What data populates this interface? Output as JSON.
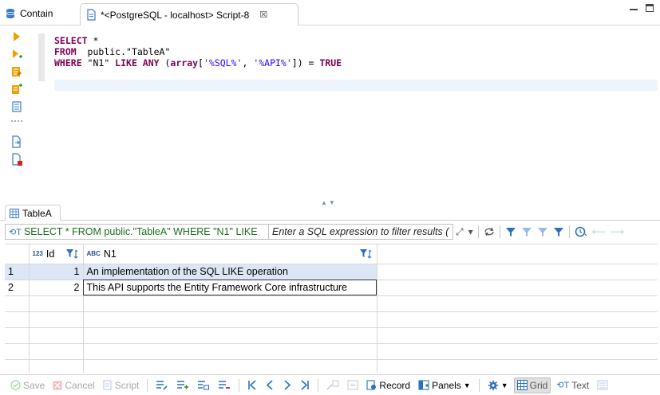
{
  "tabs": {
    "contain": "Contain",
    "script": "*<PostgreSQL - localhost> Script-8",
    "close_glyph": "☒"
  },
  "editor": {
    "line1": {
      "kw": "SELECT",
      "rest": " *"
    },
    "line2": {
      "kw": "FROM",
      "rest": "  public.\"TableA\""
    },
    "line3": {
      "kw1": "WHERE",
      "t1": " \"N1\" ",
      "kw2": "LIKE ANY",
      "t2": " (",
      "kw3": "array",
      "t3": "[",
      "s1": "'%SQL%'",
      "t4": ", ",
      "s2": "'%API%'",
      "t5": "]) = ",
      "kw4": "TRUE"
    }
  },
  "results": {
    "tab_label": "TableA",
    "filter_query": "SELECT * FROM public.\"TableA\" WHERE \"N1\" LIKE",
    "filter_placeholder": "Enter a SQL expression to filter results (use Ctrl+Space)",
    "columns": [
      {
        "type": "123",
        "name": "Id"
      },
      {
        "type": "ABC",
        "name": "N1"
      }
    ],
    "rows": [
      {
        "num": "1",
        "id": "1",
        "n1": "An implementation of the SQL LIKE operation"
      },
      {
        "num": "2",
        "id": "2",
        "n1": "This API supports the Entity Framework Core infrastructure"
      }
    ]
  },
  "toolbar": {
    "save": "Save",
    "cancel": "Cancel",
    "script": "Script",
    "record": "Record",
    "panels": "Panels",
    "grid": "Grid",
    "text": "Text"
  },
  "colors": {
    "keyword": "#7f0055",
    "string": "#2a00ff",
    "selection": "#dce6f4",
    "accent": "#2f6fbf"
  }
}
